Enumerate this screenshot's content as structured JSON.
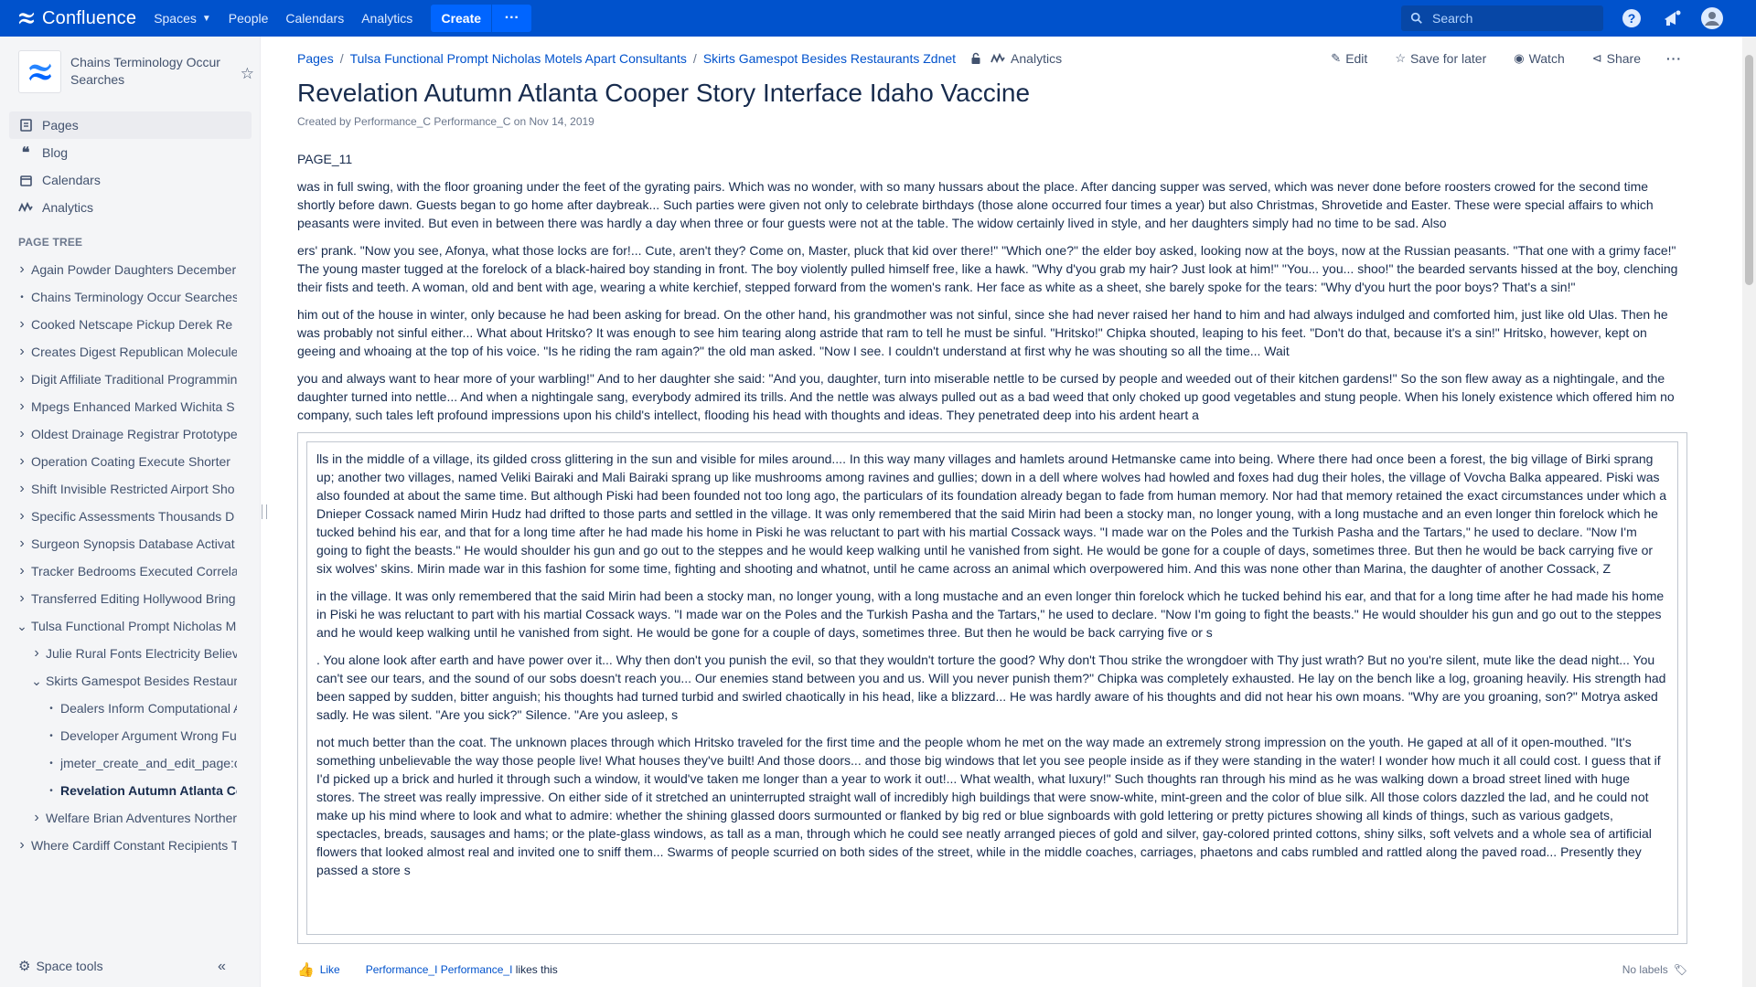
{
  "topbar": {
    "logo_text": "Confluence",
    "nav": [
      "Spaces",
      "People",
      "Calendars",
      "Analytics"
    ],
    "create_label": "Create",
    "more_label": "···",
    "search_placeholder": "Search",
    "brand_color": "#0052cc"
  },
  "sidebar": {
    "space_name": "Chains Terminology Occur Searches",
    "nav_items": [
      {
        "label": "Pages",
        "icon": "pages-icon"
      },
      {
        "label": "Blog",
        "icon": "blog-quote-icon"
      },
      {
        "label": "Calendars",
        "icon": "calendar-icon"
      },
      {
        "label": "Analytics",
        "icon": "analytics-icon"
      }
    ],
    "tree_title": "PAGE TREE",
    "tree": [
      {
        "label": "Again Powder Daughters December",
        "level": 0,
        "toggle": "collapsed"
      },
      {
        "label": "Chains Terminology Occur Searches",
        "level": 0,
        "toggle": "leaf"
      },
      {
        "label": "Cooked Netscape Pickup Derek Re",
        "level": 0,
        "toggle": "collapsed"
      },
      {
        "label": "Creates Digest Republican Molecule",
        "level": 0,
        "toggle": "collapsed"
      },
      {
        "label": "Digit Affiliate Traditional Programmin",
        "level": 0,
        "toggle": "collapsed"
      },
      {
        "label": "Mpegs Enhanced Marked Wichita S",
        "level": 0,
        "toggle": "collapsed"
      },
      {
        "label": "Oldest Drainage Registrar Prototype",
        "level": 0,
        "toggle": "collapsed"
      },
      {
        "label": "Operation Coating Execute Shorter",
        "level": 0,
        "toggle": "collapsed"
      },
      {
        "label": "Shift Invisible Restricted Airport Sho",
        "level": 0,
        "toggle": "collapsed"
      },
      {
        "label": "Specific Assessments Thousands D",
        "level": 0,
        "toggle": "collapsed"
      },
      {
        "label": "Surgeon Synopsis Database Activat",
        "level": 0,
        "toggle": "collapsed"
      },
      {
        "label": "Tracker Bedrooms Executed Correla",
        "level": 0,
        "toggle": "collapsed"
      },
      {
        "label": "Transferred Editing Hollywood Bring",
        "level": 0,
        "toggle": "collapsed"
      },
      {
        "label": "Tulsa Functional Prompt Nicholas M",
        "level": 0,
        "toggle": "expanded"
      },
      {
        "label": "Julie Rural Fonts Electricity Believ",
        "level": 1,
        "toggle": "collapsed"
      },
      {
        "label": "Skirts Gamespot Besides Restaur",
        "level": 1,
        "toggle": "expanded"
      },
      {
        "label": "Dealers Inform Computational A",
        "level": 2,
        "toggle": "leaf"
      },
      {
        "label": "Developer Argument Wrong Fur",
        "level": 2,
        "toggle": "leaf"
      },
      {
        "label": "jmeter_create_and_edit_page:c",
        "level": 2,
        "toggle": "leaf"
      },
      {
        "label": "Revelation Autumn Atlanta Co",
        "level": 2,
        "toggle": "leaf",
        "current": true
      },
      {
        "label": "Welfare Brian Adventures Norther",
        "level": 1,
        "toggle": "collapsed"
      },
      {
        "label": "Where Cardiff Constant Recipients T",
        "level": 0,
        "toggle": "collapsed"
      }
    ],
    "space_tools": "Space tools"
  },
  "breadcrumb": {
    "items": [
      "Pages",
      "Tulsa Functional Prompt Nicholas Motels Apart Consultants",
      "Skirts Gamespot Besides Restaurants Zdnet"
    ],
    "analytics": "Analytics"
  },
  "actions": {
    "edit": "Edit",
    "save": "Save for later",
    "watch": "Watch",
    "share": "Share",
    "more": "···"
  },
  "page": {
    "title": "Revelation Autumn Atlanta Cooper Story Interface Idaho Vaccine",
    "byline": "Created by Performance_C Performance_C on Nov 14, 2019",
    "paragraphs": [
      "PAGE_11",
      "was in full swing, with the floor groaning under the feet of the gyrating pairs. Which was no wonder, with so many hussars about the place. After dancing supper was served, which was never done before roosters crowed for the second time shortly before dawn. Guests began to go home after daybreak... Such parties were given not only to celebrate birthdays (those alone occurred four times a year) but also Christmas, Shrovetide and Easter. These were special affairs to which peasants were invited. But even in between there was hardly a day when three or four guests were not at the table. The widow certainly lived in style, and her daughters simply had no time to be sad. Also",
      "ers' prank. \"Now you see, Afonya, what those locks are for!... Cute, aren't they? Come on, Master, pluck that kid over there!\" \"Which one?\" the elder boy asked, looking now at the boys, now at the Russian peasants. \"That one with a grimy face!\" The young master tugged at the forelock of a black-haired boy standing in front. The boy violently pulled himself free, like a hawk. \"Why d'you grab my hair? Just look at him!\" \"You... you... shoo!\" the bearded servants hissed at the boy, clenching their fists and teeth. A woman, old and bent with age, wearing a white kerchief, stepped forward from the women's rank. Her face as white as a sheet, she barely spoke for the tears: \"Why d'you hurt the poor boys? That's a sin!\"",
      "him out of the house in winter, only because he had been asking for bread. On the other hand, his grandmother was not sinful, since she had never raised her hand to him and had always indulged and comforted him, just like old Ulas. Then he was probably not sinful either... What about Hritsko? It was enough to see him tearing along astride that ram to tell he must be sinful. \"Hritsko!\" Chipka shouted, leaping to his feet. \"Don't do that, because it's a sin!\" Hritsko, however, kept on geeing and whoaing at the top of his voice. \"Is he riding the ram again?\" the old man asked. \"Now I see. I couldn't understand at first why he was shouting so all the time... Wait",
      "you and always want to hear more of your warbling!\" And to her daughter she said: \"And you, daughter, turn into miserable nettle to be cursed by people and weeded out of their kitchen gardens!\" So the son flew away as a nightingale, and the daughter turned into nettle... And when a nightingale sang, everybody admired its trills. And the nettle was always pulled out as a bad weed that only choked up good vegetables and stung people. When his lonely existence which offered him no company, such tales left profound impressions upon his child's intellect, flooding his head with thoughts and ideas. They penetrated deep into his ardent heart a"
    ],
    "panel_paragraphs": [
      "lls in the middle of a village, its gilded cross glittering in the sun and visible for miles around.... In this way many villages and hamlets around Hetmanske came into being. Where there had once been a forest, the big village of Birki sprang up; another two villages, named Veliki Bairaki and Mali Bairaki sprang up like mushrooms among ravines and gullies; down in a dell where wolves had howled and foxes had dug their holes, the village of Vovcha Balka appeared. Piski was also founded at about the same time. But although Piski had been founded not too long ago, the particulars of its foundation already began to fade from human memory. Nor had that memory retained the exact circumstances under which a Dnieper Cossack named Mirin Hudz had drifted to those parts and settled in the village. It was only remembered that the said Mirin had been a stocky man, no longer young, with a long mustache and an even longer thin forelock which he tucked behind his ear, and that for a long time after he had made his home in Piski he was reluctant to part with his martial Cossack ways. \"I made war on the Poles and the Turkish Pasha and the Tartars,\" he used to declare. \"Now I'm going to fight the beasts.\" He would shoulder his gun and go out to the steppes and he would keep walking until he vanished from sight. He would be gone for a couple of days, sometimes three. But then he would be back carrying five or six wolves' skins. Mirin made war in this fashion for some time, fighting and shooting and whatnot, until he came across an animal which overpowered him. And this was none other than Marina, the daughter of another Cossack, Z",
      "in the village. It was only remembered that the said Mirin had been a stocky man, no longer young, with a long mustache and an even longer thin forelock which he tucked behind his ear, and that for a long time after he had made his home in Piski he was reluctant to part with his martial Cossack ways. \"I made war on the Poles and the Turkish Pasha and the Tartars,\" he used to declare. \"Now I'm going to fight the beasts.\" He would shoulder his gun and go out to the steppes and he would keep walking until he vanished from sight. He would be gone for a couple of days, sometimes three. But then he would be back carrying five or s",
      ". You alone look after earth and have power over it... Why then don't you punish the evil, so that they wouldn't torture the good? Why don't Thou strike the wrongdoer with Thy just wrath? But no you're silent, mute like the dead night... You can't see our tears, and the sound of our sobs doesn't reach you... Our enemies stand between you and us. Will you never punish them?\" Chipka was completely exhausted. He lay on the bench like a log, groaning heavily. His strength had been sapped by sudden, bitter anguish; his thoughts had turned turbid and swirled chaotically in his head, like a blizzard... He was hardly aware of his thoughts and did not hear his own moans. \"Why are you groaning, son?\" Motrya asked sadly. He was silent. \"Are you sick?\" Silence. \"Are you asleep, s",
      "not much better than the coat. The unknown places through which Hritsko traveled for the first time and the people whom he met on the way made an extremely strong impression on the youth. He gaped at all of it open-mouthed. \"It's something unbelievable the way those people live! What houses they've built! And those doors... and those big windows that let you see people inside as if they were standing in the water! I wonder how much it all could cost. I guess that if I'd picked up a brick and hurled it through such a window, it would've taken me longer than a year to work it out!... What wealth, what luxury!\" Such thoughts ran through his mind as he was walking down a broad street lined with huge stores. The street was really impressive. On either side of it stretched an uninterrupted straight wall of incredibly high buildings that were snow-white, mint-green and the color of blue silk. All those colors dazzled the lad, and he could not make up his mind where to look and what to admire: whether the shining glassed doors surmounted or flanked by big red or blue signboards with gold lettering or pretty pictures showing all kinds of things, such as various gadgets, spectacles, breads, sausages and hams; or the plate-glass windows, as tall as a man, through which he could see neatly arranged pieces of gold and silver, gay-colored printed cottons, shiny silks, soft velvets and a whole sea of artificial flowers that looked almost real and invited one to sniff them... Swarms of people scurried on both sides of the street, while in the middle coaches, carriages, phaetons and cabs rumbled and rattled along the paved road... Presently they passed a store s"
    ]
  },
  "footer": {
    "like": "Like",
    "likers_link": "Performance_I Performance_I",
    "likers_suffix": " likes this",
    "labels": "No labels"
  }
}
